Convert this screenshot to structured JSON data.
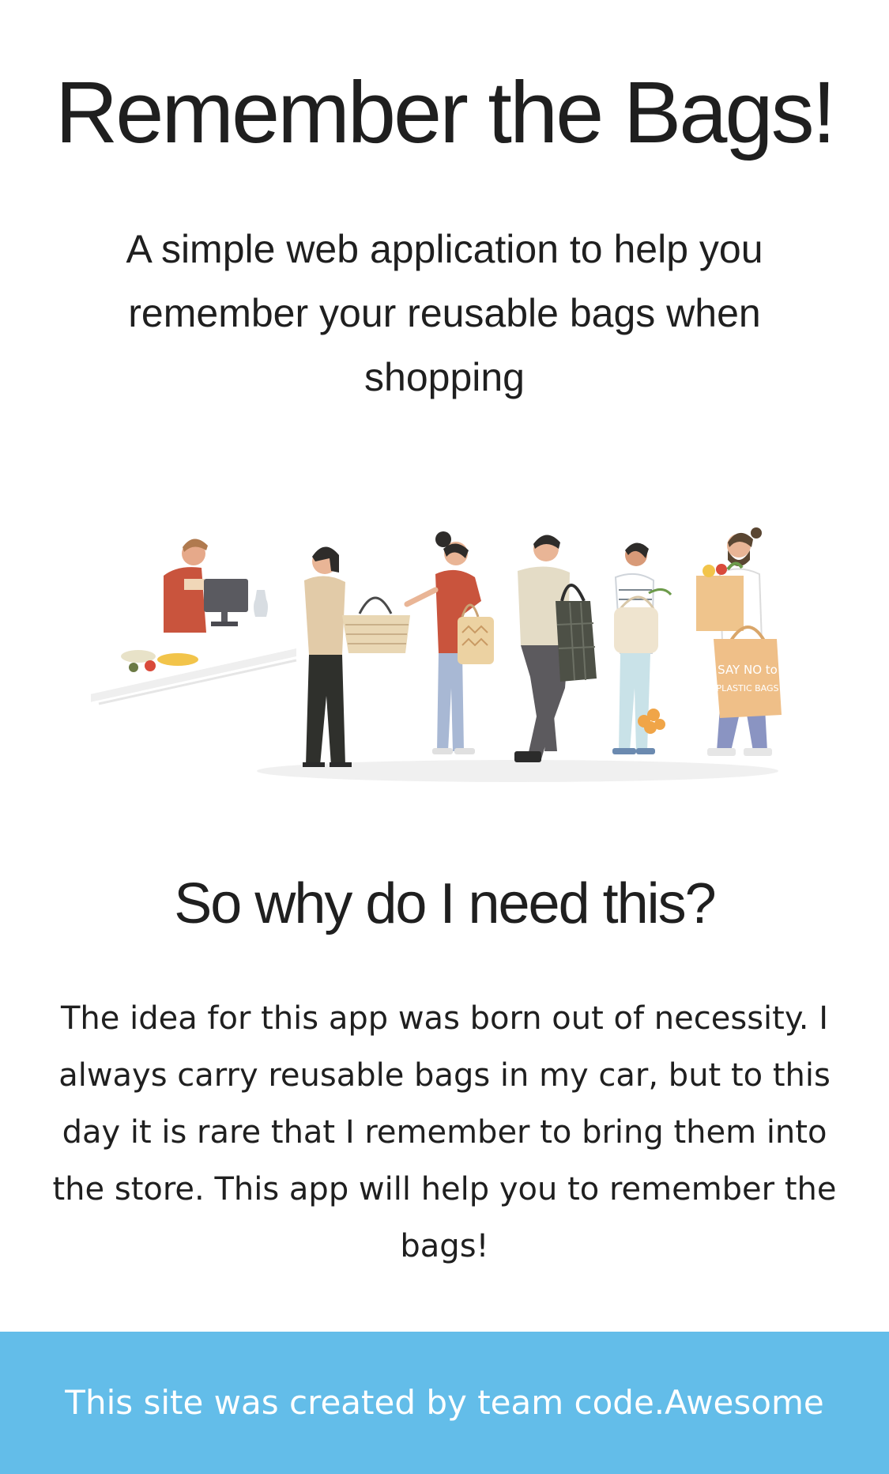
{
  "hero": {
    "title": "Remember the Bags!",
    "subtitle": "A simple web application to help you remember your reusable bags when shopping"
  },
  "illustration": {
    "icon": "people-shopping-with-reusable-bags-illustration",
    "bag_text_line1": "SAY NO to",
    "bag_text_line2": "PLASTIC BAGS"
  },
  "why": {
    "heading": "So why do I need this?",
    "body": "The idea for this app was born out of necessity. I always carry reusable bags in my car, but to this day it is rare that I remember to bring them into the store. This app will help you to remember the bags!"
  },
  "footer": {
    "text": "This site was created by team code.Awesome",
    "background_color": "#63bde9"
  }
}
